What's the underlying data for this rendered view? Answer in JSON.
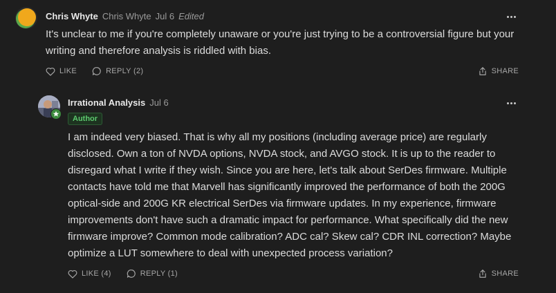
{
  "comments": [
    {
      "author": "Chris Whyte",
      "author_secondary": "Chris Whyte",
      "date": "Jul 6",
      "edited": "Edited",
      "text": "It's unclear to me if you're completely unaware or you're just trying to be a controversial figure but your writing and therefore analysis is riddled with bias.",
      "like_label": "LIKE",
      "reply_label": "REPLY (2)",
      "share_label": "SHARE"
    },
    {
      "author": "Irrational Analysis",
      "date": "Jul 6",
      "badge": "Author",
      "text": "I am indeed very biased. That is why all my positions (including average price) are regularly disclosed. Own a ton of NVDA options, NVDA stock, and AVGO stock. It is up to the reader to disregard what I write if they wish. Since you are here, let's talk about SerDes firmware. Multiple contacts have told me that Marvell has significantly improved the performance of both the 200G optical-side and 200G KR electrical SerDes via firmware updates. In my experience, firmware improvements don't have such a dramatic impact for performance. What specifically did the new firmware improve? Common mode calibration? ADC cal? Skew cal? CDR INL correction? Maybe optimize a LUT somewhere to deal with unexpected process variation?",
      "like_label": "LIKE (4)",
      "reply_label": "REPLY (1)",
      "share_label": "SHARE"
    }
  ],
  "colors": {
    "background": "#1e1e1e",
    "badge_green": "#5cc96e",
    "avatar_orange": "#f0a81c",
    "avatar_green": "#5aa84a"
  },
  "icons": [
    "heart-icon",
    "speech-bubble-icon",
    "share-icon",
    "more-icon",
    "star-icon"
  ]
}
